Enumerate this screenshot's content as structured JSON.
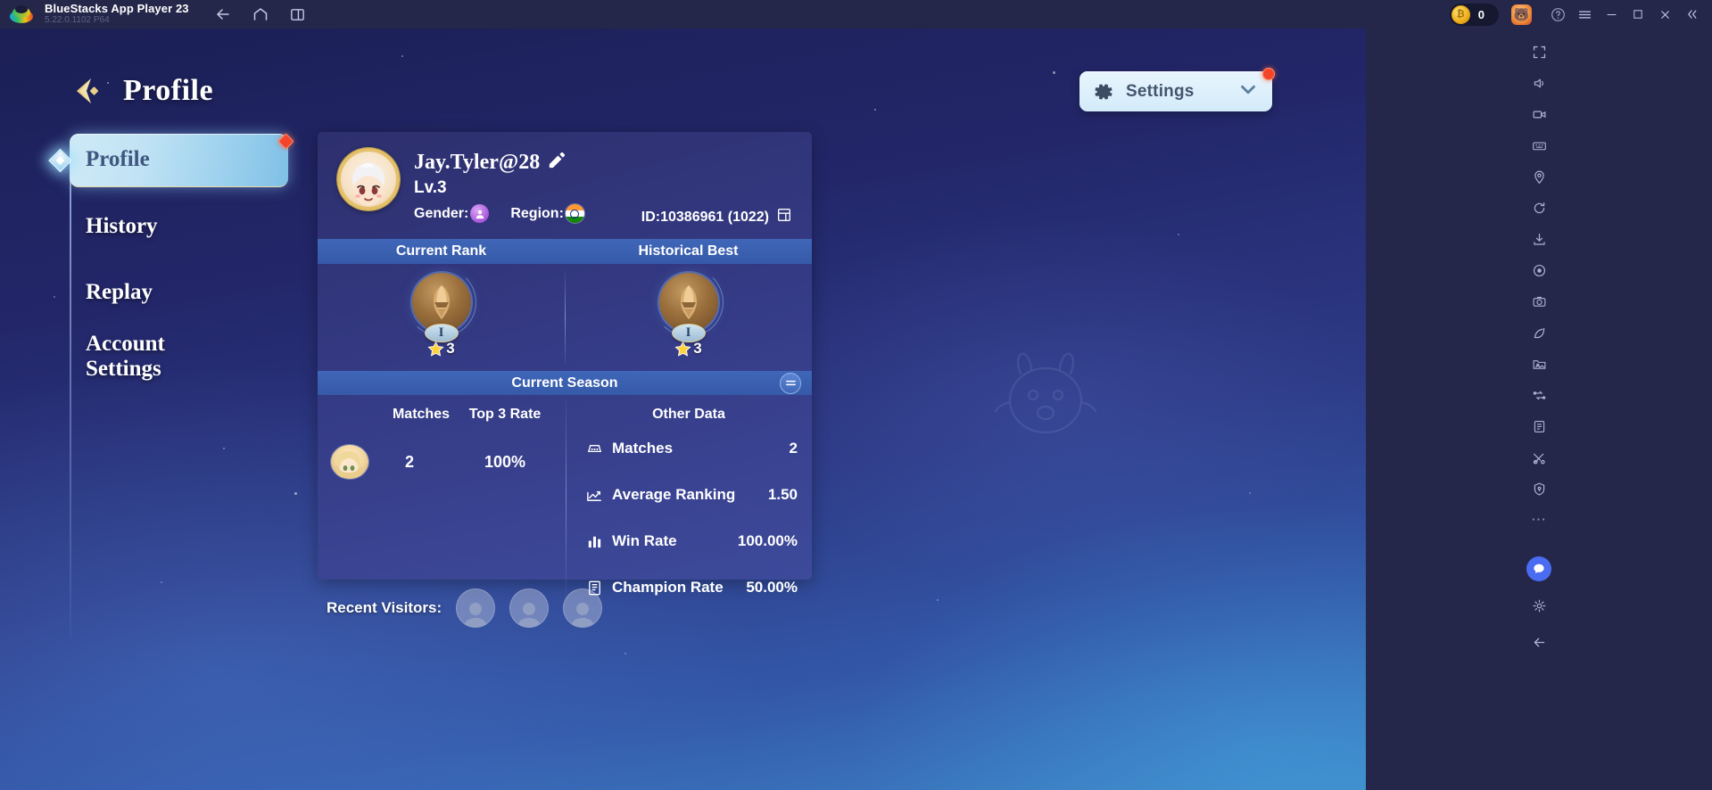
{
  "titlebar": {
    "app_name": "BlueStacks App Player 23",
    "version": "5.22.0.1102  P64",
    "logo_icon": "bluestacks-logo",
    "nav": [
      {
        "name": "back",
        "icon": "arrow-left-icon"
      },
      {
        "name": "home",
        "icon": "home-icon"
      },
      {
        "name": "multi-instance",
        "icon": "windows-copy-icon"
      }
    ],
    "coin_value": "0",
    "coin_icon": "coin-icon",
    "account_icon": "bear-avatar-icon",
    "controls": [
      {
        "name": "help",
        "icon": "help-circle-icon"
      },
      {
        "name": "menu",
        "icon": "hamburger-menu-icon"
      },
      {
        "name": "minimize",
        "icon": "minimize-icon"
      },
      {
        "name": "maximize",
        "icon": "maximize-icon"
      },
      {
        "name": "close",
        "icon": "close-icon"
      },
      {
        "name": "collapse",
        "icon": "chevron-double-left-icon"
      }
    ]
  },
  "game": {
    "header": {
      "back_icon": "back-chevron-icon",
      "title": "Profile"
    },
    "sidebar": {
      "items": [
        {
          "label": "Profile",
          "active": true,
          "badge": true
        },
        {
          "label": "History",
          "active": false,
          "badge": false
        },
        {
          "label": "Replay",
          "active": false,
          "badge": false
        },
        {
          "label": "Account Settings",
          "label_line1": "Account",
          "label_line2": "Settings",
          "active": false,
          "badge": false
        }
      ]
    },
    "settings_button": {
      "label": "Settings",
      "gear_icon": "gear-icon",
      "chevron_icon": "chevron-down-icon",
      "badge": true
    },
    "profile": {
      "avatar_icon": "player-avatar",
      "name": "Jay.Tyler@28",
      "edit_icon": "edit-pencil-icon",
      "level": "Lv.3",
      "gender_label": "Gender:",
      "gender_icon": "gender-unknown-icon",
      "region_label": "Region:",
      "region_icon": "flag-india-icon",
      "id_text": "ID:10386961 (1022)",
      "copy_icon": "copy-icon"
    },
    "rank": {
      "current_label": "Current Rank",
      "historical_label": "Historical Best",
      "current": {
        "tier": "I",
        "stars": "3",
        "medal_icon": "warrior-helmet-medal"
      },
      "historical": {
        "tier": "I",
        "stars": "3",
        "medal_icon": "warrior-helmet-medal"
      }
    },
    "season": {
      "title": "Current Season",
      "swap_icon": "swap-arrows-icon",
      "left_headers": {
        "matches": "Matches",
        "top3": "Top 3 Rate"
      },
      "left_row": {
        "hero_icon": "hero-portrait",
        "matches": "2",
        "top3": "100%"
      },
      "right_header": "Other Data",
      "other_data": [
        {
          "icon": "matches-icon",
          "label": "Matches",
          "value": "2"
        },
        {
          "icon": "ranking-chart-icon",
          "label": "Average Ranking",
          "value": "1.50"
        },
        {
          "icon": "bar-chart-icon",
          "label": "Win Rate",
          "value": "100.00%"
        },
        {
          "icon": "champion-icon",
          "label": "Champion Rate",
          "value": "50.00%"
        }
      ]
    },
    "visitors": {
      "label": "Recent Visitors:",
      "slots": [
        {
          "icon": "visitor-placeholder-icon"
        },
        {
          "icon": "visitor-placeholder-icon"
        },
        {
          "icon": "visitor-placeholder-icon"
        }
      ]
    },
    "mascot_icon": "bluestacks-mascot-watermark"
  },
  "toolbar": {
    "tools": [
      {
        "name": "fullscreen",
        "icon": "fullscreen-icon"
      },
      {
        "name": "volume",
        "icon": "volume-icon"
      },
      {
        "name": "video",
        "icon": "video-icon"
      },
      {
        "name": "gamepad-controls",
        "icon": "keyboard-controls-icon"
      },
      {
        "name": "location",
        "icon": "location-pin-icon"
      },
      {
        "name": "rotate",
        "icon": "rotate-icon"
      },
      {
        "name": "install-apk",
        "icon": "install-apk-icon"
      },
      {
        "name": "macro",
        "icon": "macro-record-icon"
      },
      {
        "name": "screenshot",
        "icon": "camera-icon"
      },
      {
        "name": "eco-mode",
        "icon": "eco-leaf-icon"
      },
      {
        "name": "media-manager",
        "icon": "media-folder-icon"
      },
      {
        "name": "multi-instance-sync",
        "icon": "sync-instances-icon"
      },
      {
        "name": "script",
        "icon": "script-icon"
      },
      {
        "name": "trim",
        "icon": "trim-icon"
      },
      {
        "name": "shield",
        "icon": "shield-icon"
      },
      {
        "name": "more",
        "icon": "more-dots-icon"
      },
      {
        "name": "chat-support",
        "icon": "chat-bubble-icon"
      },
      {
        "name": "settings",
        "icon": "gear-icon"
      },
      {
        "name": "back-nav",
        "icon": "arrow-left-icon"
      }
    ]
  },
  "colors": {
    "titlebar_bg": "#242749",
    "accent_blue": "#3f66b8",
    "card_bg": "#363c87",
    "badge_red": "#f4452a",
    "gold": "#e3c069",
    "settings_pill": "#ddeefb"
  }
}
